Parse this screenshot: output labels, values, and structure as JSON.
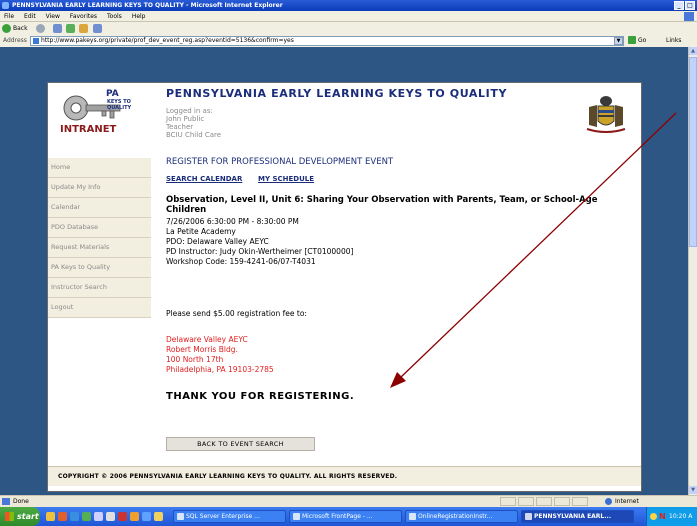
{
  "window": {
    "title": "PENNSYLVANIA EARLY LEARNING KEYS TO QUALITY - Microsoft Internet Explorer"
  },
  "menu": [
    "File",
    "Edit",
    "View",
    "Favorites",
    "Tools",
    "Help"
  ],
  "toolbar": {
    "back_label": "Back"
  },
  "address": {
    "label": "Address",
    "url": "http://www.pakeys.org/private/prof_dev_event_reg.asp?eventid=5136&confirm=yes",
    "go_label": "Go",
    "links_label": "Links"
  },
  "logo": {
    "line1": "PA",
    "line2": "KEYS TO",
    "line3": "QUALITY",
    "line4": "INTRANET"
  },
  "site": {
    "title": "PENNSYLVANIA EARLY LEARNING KEYS TO QUALITY",
    "login": [
      "Logged in as:",
      "John Public",
      "Teacher",
      "BCIU Child Care"
    ]
  },
  "nav": [
    "Home",
    "Update My Info",
    "Calendar",
    "PDO Database",
    "Request Materials",
    "PA Keys to Quality",
    "Instructor Search",
    "Logout"
  ],
  "content": {
    "heading": "REGISTER FOR PROFESSIONAL DEVELOPMENT EVENT",
    "link_calendar": "SEARCH CALENDAR",
    "link_schedule": "MY SCHEDULE",
    "event_title": "Observation, Level II, Unit 6: Sharing Your Observation with Parents, Team, or School-Age Children",
    "event_lines": [
      "7/26/2006 6:30:00 PM - 8:30:00 PM",
      "La Petite Academy",
      "PDO: Delaware Valley AEYC",
      "PD Instructor: Judy Okin-Wertheimer [CT0100000]",
      "Workshop Code: 159-4241-06/07-T4031"
    ],
    "fee_text": "Please send $5.00 registration fee to:",
    "address_lines": [
      "Delaware Valley AEYC",
      "Robert Morris Bldg.",
      "100 North 17th",
      "Philadelphia, PA 19103-2785"
    ],
    "thanks": "THANK YOU FOR REGISTERING.",
    "back_button": "BACK TO EVENT SEARCH",
    "copyright": "COPYRIGHT © 2006 PENNSYLVANIA EARLY LEARNING KEYS TO QUALITY. ALL RIGHTS RESERVED."
  },
  "status": {
    "text": "Done",
    "zone": "Internet"
  },
  "taskbar": {
    "start": "start",
    "tasks": [
      "SQL Server Enterprise ...",
      "Microsoft FrontPage - ...",
      "OnlineRegistrationInstr...",
      "PENNSYLVANIA EARL..."
    ],
    "tray_letter": "N",
    "clock": "10:20 A"
  },
  "colors": {
    "site_blue": "#1b2d7a",
    "address_red": "#e02020",
    "page_bg": "#2d5684",
    "arrow": "#8b0000"
  }
}
